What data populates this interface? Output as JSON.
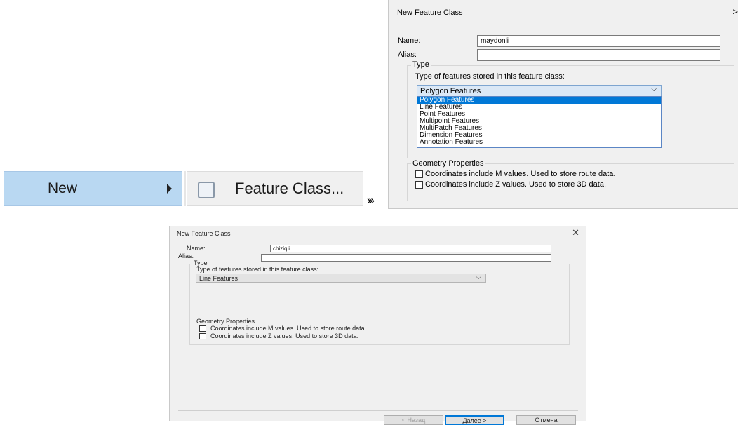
{
  "menu": {
    "new_label": "New",
    "feature_class_label": "Feature Class...",
    "chevrons": "›››"
  },
  "dialog1": {
    "title": "New Feature Class",
    "close": ">",
    "name_label": "Name:",
    "name_value": "maydonli",
    "alias_label": "Alias:",
    "alias_value": "",
    "type_group": "Type",
    "type_prompt": "Type of features stored in this feature class:",
    "selected_type": "Polygon Features",
    "options": [
      "Polygon Features",
      "Line Features",
      "Point Features",
      "Multipoint Features",
      "MultiPatch Features",
      "Dimension Features",
      "Annotation Features"
    ],
    "geometry_group": "Geometry Properties",
    "m_values_label": "Coordinates include M values. Used to store route data.",
    "z_values_label": "Coordinates include Z values. Used to store 3D data."
  },
  "dialog2": {
    "title": "New Feature Class",
    "close": "✕",
    "name_label": "Name:",
    "name_value": "chiziqli",
    "alias_label": "Alias:",
    "alias_value": "",
    "type_group": "Type",
    "type_prompt": "Type of features stored in this feature class:",
    "selected_type": "Line Features",
    "geometry_group": "Geometry Properties",
    "m_values_label": "Coordinates include M values. Used to store route data.",
    "z_values_label": "Coordinates include Z values. Used to store 3D data.",
    "back_button": "< Назад",
    "next_button": "Далее >",
    "cancel_button": "Отмена"
  }
}
